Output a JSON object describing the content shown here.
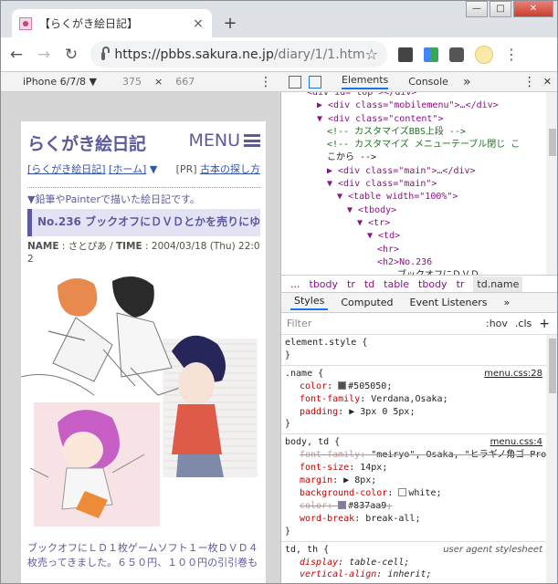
{
  "browser": {
    "tab_title": "【らくがき絵日記】",
    "tab_close": "×",
    "new_tab": "+",
    "window_controls": {
      "minimize": "—",
      "maximize": "□",
      "close": "✕"
    },
    "url_host": "https://pbbs.sakura.ne.jp",
    "url_path": "/diary/1/1.htm",
    "nav": {
      "back": "←",
      "forward": "→",
      "reload": "↻"
    },
    "star": "☆",
    "menu": "⋮"
  },
  "device_toolbar": {
    "device": "iPhone 6/7/8 ▼",
    "width": "375",
    "times": "×",
    "height": "667",
    "menu": "⋮"
  },
  "page": {
    "title": "らくがき絵日記",
    "menu_label": "MENU",
    "link1": "[らくがき絵日記]",
    "link2": "[ホーム]",
    "link_arrow": "▼",
    "pr_label": "[PR]",
    "pr_link": "古本の探し方",
    "description": "▼鉛筆やPainterで描いた絵日記です。",
    "entry_title": "No.236 ブックオフにＤＶＤとかを売りにゆく。",
    "meta_name_label": "NAME",
    "meta_name": "さとぴあ",
    "meta_time_label": "TIME",
    "meta_time": "2004/03/18 (Thu) 22:02",
    "body_text": "ブックオフにＬＤ１枚ゲームソフト１ー枚ＤＶＤ４枚売ってきました。６５０円、１００円の引引巻も"
  },
  "devtools": {
    "tabs": [
      "Elements",
      "Console"
    ],
    "more": "»",
    "menu": "⋮",
    "close": "✕",
    "dom_lines": [
      {
        "indent": 0,
        "html": "<div id=\"top\"></div>"
      },
      {
        "indent": 1,
        "html": "▶ <div class=\"mobilemenu\">…</div>"
      },
      {
        "indent": 1,
        "html": "▼ <div class=\"content\">"
      },
      {
        "indent": 2,
        "html": "<!-- カスタマイズBBS上段 -->"
      },
      {
        "indent": 2,
        "html": "<!-- カスタマイズ メニューテーブル閉じ こ"
      },
      {
        "indent": 2,
        "html": "こから -->"
      },
      {
        "indent": 2,
        "html": "▶ <div class=\"main\">…</div>"
      },
      {
        "indent": 2,
        "html": "▼ <div class=\"main\">"
      },
      {
        "indent": 3,
        "html": "▼ <table width=\"100%\">"
      },
      {
        "indent": 4,
        "html": "▼ <tbody>"
      },
      {
        "indent": 5,
        "html": "▼ <tr>"
      },
      {
        "indent": 6,
        "html": "▼ <td>"
      },
      {
        "indent": 7,
        "html": "<hr>"
      },
      {
        "indent": 7,
        "html": "<h2>No.236"
      },
      {
        "indent": 9,
        "html": "ブックオフにＤＶＤ"
      }
    ],
    "breadcrumbs": [
      "...",
      "tbody",
      "tr",
      "td",
      "table",
      "tbody",
      "tr",
      "td.name"
    ],
    "styles_tabs": [
      "Styles",
      "Computed",
      "Event Listeners"
    ],
    "styles_more": "»",
    "filter_placeholder": "Filter",
    "filter_hov": ":hov",
    "filter_cls": ".cls",
    "filter_add": "+",
    "rules": [
      {
        "selector": "element.style {",
        "source": "",
        "props": [],
        "close": "}"
      },
      {
        "selector": ".name {",
        "source": "menu.css:28",
        "props": [
          {
            "name": "color",
            "value": "#505050",
            "swatch": "#505050",
            "strike": false
          },
          {
            "name": "font-family",
            "value": "Verdana,Osaka",
            "strike": false
          },
          {
            "name": "padding",
            "value": "▶ 3px 0 5px",
            "strike": false
          }
        ],
        "close": "}"
      },
      {
        "selector": "body, td {",
        "source": "menu.css:4",
        "props": [
          {
            "name": "font-family",
            "value": "\"meiryo\", Osaka, \"ヒラギノ角ゴ Pro W3\"",
            "strike": true
          },
          {
            "name": "font-size",
            "value": "14px",
            "strike": false
          },
          {
            "name": "margin",
            "value": "▶ 8px",
            "strike": false
          },
          {
            "name": "background-color",
            "value": "white",
            "swatch": "#ffffff",
            "strike": false
          },
          {
            "name": "color",
            "value": "#837aa9",
            "swatch": "#837aa9",
            "strike": true
          },
          {
            "name": "word-break",
            "value": "break-all",
            "strike": false
          }
        ],
        "close": "}"
      },
      {
        "selector": "td, th {",
        "source": "user agent stylesheet",
        "props": [
          {
            "name": "display",
            "value": "table-cell",
            "strike": false
          },
          {
            "name": "vertical-align",
            "value": "inherit",
            "strike": false
          }
        ],
        "close": ""
      }
    ]
  }
}
